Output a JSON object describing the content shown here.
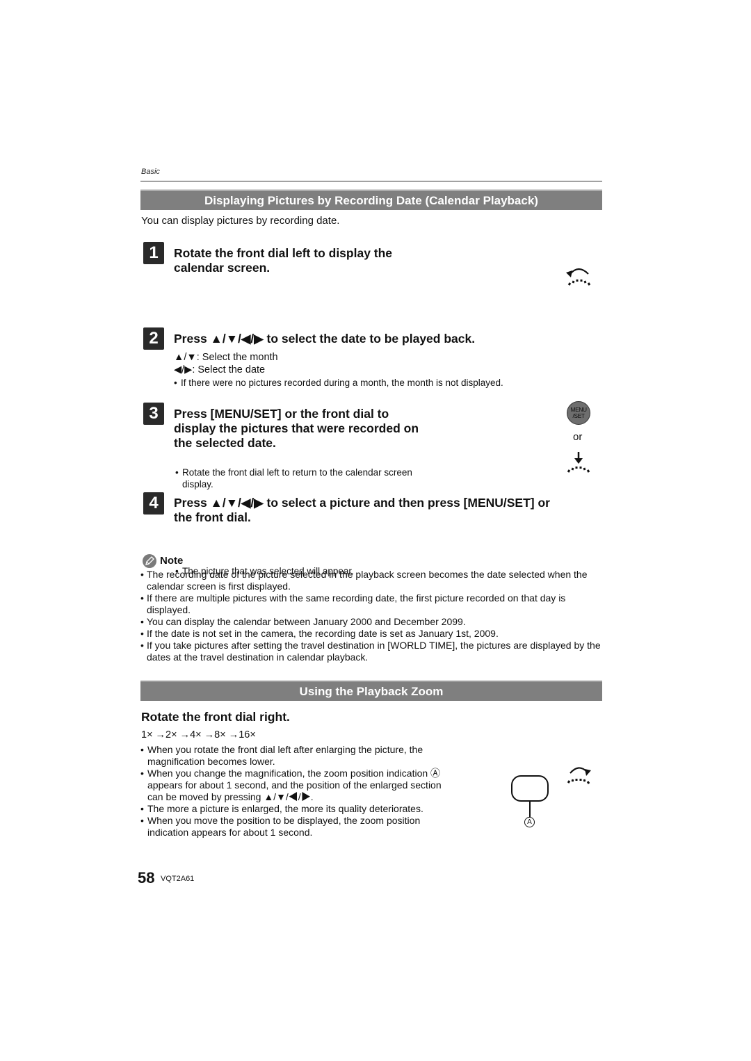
{
  "header": {
    "section_label": "Basic"
  },
  "calendar_section": {
    "title": "Displaying Pictures by Recording Date (Calendar Playback)",
    "intro": "You can display pictures by recording date.",
    "steps": [
      {
        "number": "1",
        "title_line1": "Rotate the front dial left to display the",
        "title_line2": "calendar screen.",
        "icon": "dial-rotate-left-icon"
      },
      {
        "number": "2",
        "title": "Press ▲/▼/◀/▶ to select the date to be played back.",
        "details": [
          "▲/▼:  Select the month",
          "◀/▶:  Select the date"
        ],
        "bullets": [
          "If there were no pictures recorded during a month, the month is not displayed."
        ]
      },
      {
        "number": "3",
        "title_line1": "Press [MENU/SET] or the front dial to",
        "title_line2": "display the pictures that were recorded on",
        "title_line3": "the selected date.",
        "bullets": [
          "Rotate the front dial left to return to the calendar screen display."
        ],
        "menu_button_line1": "MENU",
        "menu_button_line2": "/SET",
        "or_label": "or"
      },
      {
        "number": "4",
        "title_line1": "Press ▲/▼/◀/▶ to select a picture and then press [MENU/SET] or",
        "title_line2": "the front dial.",
        "bullets": [
          "The picture that was selected will appear."
        ]
      }
    ],
    "note": {
      "label": "Note",
      "items": [
        "The recording date of the picture selected in the playback screen becomes the date selected when the calendar screen is first displayed.",
        "If there are multiple pictures with the same recording date, the first picture recorded on that day is displayed.",
        "You can display the calendar between January 2000 and December 2099.",
        "If the date is not set in the camera, the recording date is set as January 1st, 2009.",
        "If you take pictures after setting the travel destination in [WORLD TIME], the pictures are displayed by the dates at the travel destination in calendar playback."
      ]
    }
  },
  "zoom_section": {
    "title": "Using the Playback Zoom",
    "subtitle": "Rotate the front dial right.",
    "sequence": "1× →2× →4× →8× →16×",
    "bullets": [
      "When you rotate the front dial left after enlarging the picture, the magnification becomes lower.",
      "When you change the magnification, the zoom position indication Ⓐ appears for about 1 second, and the position of the enlarged section can be moved by pressing ▲/▼/◀/▶.",
      "The more a picture is enlarged, the more its quality deteriorates.",
      "When you move the position to be displayed, the zoom position indication appears for about 1 second."
    ],
    "callout_label": "A"
  },
  "footer": {
    "page_number": "58",
    "doc_code": "VQT2A61"
  }
}
